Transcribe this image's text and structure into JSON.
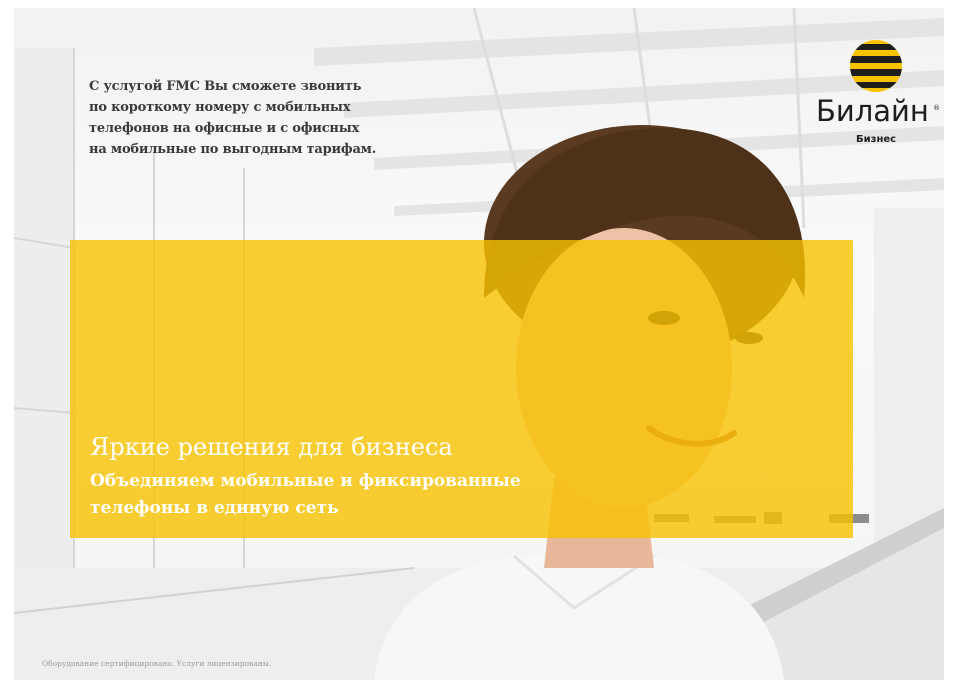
{
  "ad": {
    "intro_lines": [
      "С услугой FMC Вы сможете звонить",
      "по короткому номеру с мобильных",
      "телефонов на офисные и с офисных",
      "на мобильные по выгодным тарифам."
    ],
    "headline": "Яркие решения для бизнеса",
    "subline_lines": [
      "Объединяем мобильные и фиксированные",
      "телефоны в единую сеть"
    ],
    "footnote": "Оборудование сертифицировано. Услуги лицензированы."
  },
  "logo": {
    "brand": "Билайн",
    "registered_mark": "®",
    "subtitle": "Бизнес",
    "icon": "beeline-striped-ball-icon"
  },
  "colors": {
    "brand_yellow": "#f7c200",
    "logo_black": "#1d1d1b",
    "text_dark": "#3a3a3a",
    "headline_white": "#ffffff"
  }
}
